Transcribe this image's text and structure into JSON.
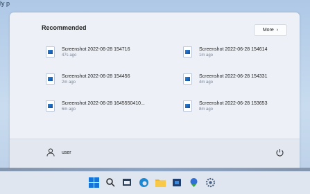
{
  "top_text": "ly p",
  "start_menu": {
    "recommended_title": "Recommended",
    "more_button": {
      "label": "More",
      "chevron": "›"
    },
    "items": [
      {
        "name": "Screenshot 2022-06-28 154716",
        "time": "47s ago",
        "icon": "image-file-icon"
      },
      {
        "name": "Screenshot 2022-06-28 154614",
        "time": "1m ago",
        "icon": "image-file-icon"
      },
      {
        "name": "Screenshot 2022-06-28 154456",
        "time": "2m ago",
        "icon": "image-file-icon"
      },
      {
        "name": "Screenshot 2022-06-28 154331",
        "time": "4m ago",
        "icon": "image-file-icon"
      },
      {
        "name": "Screenshot 2022-06-28 1645550410...",
        "time": "6m ago",
        "icon": "image-file-icon"
      },
      {
        "name": "Screenshot 2022-06-28 153653",
        "time": "8m ago",
        "icon": "image-file-icon"
      }
    ],
    "user": {
      "name": "user",
      "icon": "user-icon"
    },
    "power_icon": "power-icon"
  },
  "taskbar": {
    "icons": [
      "windows-start-icon",
      "search-icon",
      "file-explorer-icon",
      "edge-browser-icon",
      "folder-icon",
      "store-icon",
      "app-icon",
      "settings-icon"
    ]
  },
  "colors": {
    "accent": "#1673d8",
    "menu_bg": "#edf1f7"
  }
}
